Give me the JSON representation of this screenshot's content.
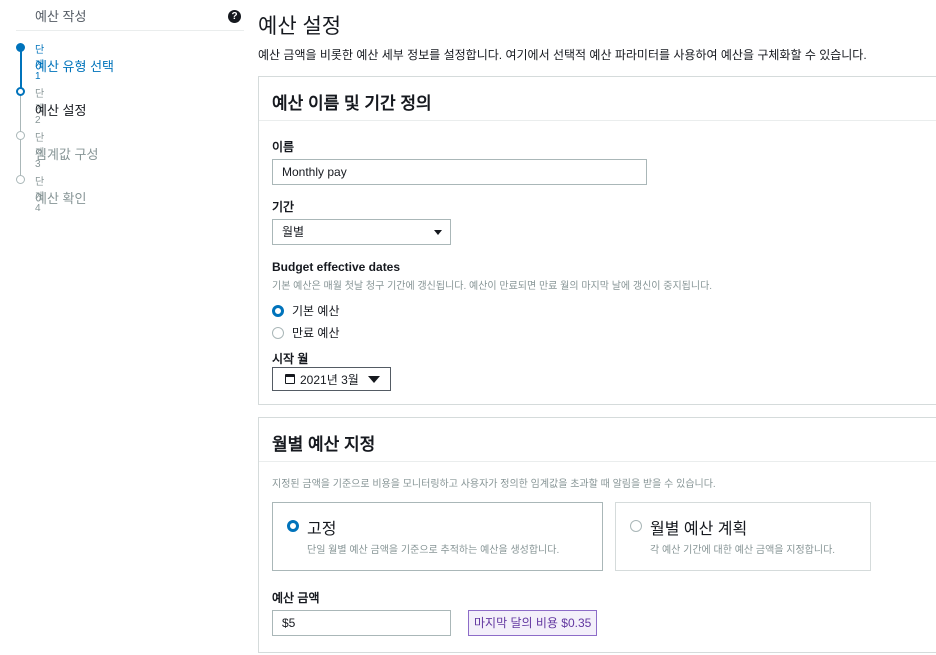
{
  "sidebar": {
    "title": "예산 작성",
    "help_icon": "question-circle-icon",
    "steps": [
      {
        "num": "단계 1",
        "name": "예산 유형 선택"
      },
      {
        "num": "단계 2",
        "name": "예산 설정"
      },
      {
        "num": "단계 3",
        "name": "임계값 구성"
      },
      {
        "num": "단계 4",
        "name": "예산 확인"
      }
    ]
  },
  "main": {
    "title": "예산 설정",
    "description": "예산 금액을 비롯한 예산 세부 정보를 설정합니다. 여기에서 선택적 예산 파라미터를 사용하여 예산을 구체화할 수 있습니다."
  },
  "name_panel": {
    "title": "예산 이름 및 기간 정의",
    "name_label": "이름",
    "name_value": "Monthly pay",
    "period_label": "기간",
    "period_value": "월별",
    "effective_label": "Budget effective dates",
    "effective_hint": "기본 예산은 매월 첫날 청구 기간에 갱신됩니다. 예산이 만료되면 만료 월의 마지막 날에 갱신이 중지됩니다.",
    "option_recurring": "기본 예산",
    "option_expiring": "만료 예산",
    "start_label": "시작 월",
    "start_value": "2021년 3월"
  },
  "amount_panel": {
    "title": "월별 예산 지정",
    "hint": "지정된 금액을 기준으로 비용을 모니터링하고 사용자가 정의한 임계값을 초과할 때 알림을 받을 수 있습니다.",
    "fixed_title": "고정",
    "fixed_desc": "단일 월별 예산 금액을 기준으로 추적하는 예산을 생성합니다.",
    "planned_title": "월별 예산 계획",
    "planned_desc": "각 예산 기간에 대한 예산 금액을 지정합니다.",
    "amount_label": "예산 금액",
    "amount_value": "$5",
    "last_month_cost": "마지막 달의 비용 $0.35"
  },
  "colors": {
    "accent": "#0073bb",
    "badge_border": "#8d6cc8",
    "badge_bg": "#f3effa"
  }
}
